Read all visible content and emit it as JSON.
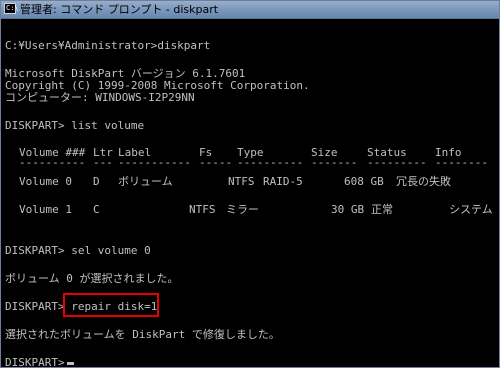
{
  "window": {
    "title": "管理者: コマンド プロンプト - diskpart"
  },
  "console": {
    "lines": [
      "C:¥Users¥Administrator>diskpart",
      "Microsoft DiskPart バージョン 6.1.7601",
      "Copyright (C) 1999-2008 Microsoft Corporation.",
      "コンピューター: WINDOWS-I2P29NN",
      "DISKPART> list volume",
      "DISKPART> sel volume 0",
      "ボリューム 0 が選択されました。",
      "DISKPART> repair disk=1",
      "選択されたボリュームを DiskPart で修復しました。",
      "DISKPART> "
    ],
    "volume_table": {
      "headers": [
        "Volume ###",
        "Ltr",
        "Label",
        "Fs",
        "Type",
        "Size",
        "Status",
        "Info"
      ],
      "separators": [
        "----------",
        "---",
        "-----------",
        "-----",
        "----------",
        "-------",
        "---------",
        "--------"
      ],
      "rows": [
        [
          "Volume 0",
          "D",
          "ボリューム",
          "NTFS",
          "RAID-5",
          "608 GB",
          "冗長の失敗",
          ""
        ],
        [
          "Volume 1",
          "C",
          "",
          "NTFS",
          "ミラー",
          "30 GB",
          "正常",
          "システム"
        ]
      ]
    }
  }
}
